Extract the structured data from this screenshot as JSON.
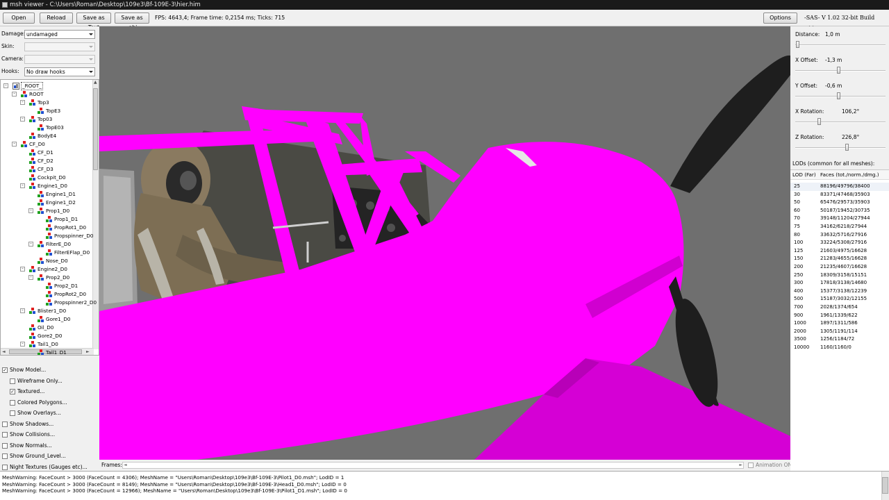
{
  "window": {
    "title": "msh viewer - C:\\Users\\Roman\\Desktop\\109e3\\Bf-109E-3\\hier.him"
  },
  "toolbar": {
    "open_label": "Open",
    "reload_label": "Reload",
    "save_text_label": "Save as Text",
    "save_obj_label": "Save as .obj",
    "stats": "FPS: 4643,4; Frame time: 0,2154 ms; Ticks: 715",
    "options_label": "Options",
    "build": "-SAS- V 1.02  32-bit  Build 311e"
  },
  "left": {
    "damage_label": "Damage:",
    "damage_value": "undamaged",
    "skin_label": "Skin:",
    "skin_value": "",
    "camera_label": "Camera:",
    "camera_value": "",
    "hooks_label": "Hooks:",
    "hooks_value": "No draw hooks"
  },
  "tree": [
    {
      "label": "_ROOT_",
      "depth": 0,
      "exp": "-",
      "icon": "root"
    },
    {
      "label": "ROOT",
      "depth": 1,
      "exp": "-",
      "icon": "node"
    },
    {
      "label": "Top3",
      "depth": 2,
      "exp": "-",
      "icon": "node"
    },
    {
      "label": "TopE3",
      "depth": 3,
      "exp": "",
      "icon": "mesh"
    },
    {
      "label": "Top03",
      "depth": 2,
      "exp": "-",
      "icon": "node"
    },
    {
      "label": "TopE03",
      "depth": 3,
      "exp": "",
      "icon": "mesh"
    },
    {
      "label": "BodyE4",
      "depth": 2,
      "exp": "",
      "icon": "mesh"
    },
    {
      "label": "CF_D0",
      "depth": 1,
      "exp": "-",
      "icon": "node"
    },
    {
      "label": "CF_D1",
      "depth": 2,
      "exp": "",
      "icon": "mesh"
    },
    {
      "label": "CF_D2",
      "depth": 2,
      "exp": "",
      "icon": "mesh"
    },
    {
      "label": "CF_D3",
      "depth": 2,
      "exp": "",
      "icon": "mesh"
    },
    {
      "label": "Cockpit_D0",
      "depth": 2,
      "exp": "",
      "icon": "mesh"
    },
    {
      "label": "Engine1_D0",
      "depth": 2,
      "exp": "-",
      "icon": "node"
    },
    {
      "label": "Engine1_D1",
      "depth": 3,
      "exp": "",
      "icon": "mesh"
    },
    {
      "label": "Engine1_D2",
      "depth": 3,
      "exp": "",
      "icon": "mesh"
    },
    {
      "label": "Prop1_D0",
      "depth": 3,
      "exp": "-",
      "icon": "node"
    },
    {
      "label": "Prop1_D1",
      "depth": 4,
      "exp": "",
      "icon": "mesh"
    },
    {
      "label": "PropRot1_D0",
      "depth": 4,
      "exp": "",
      "icon": "mesh"
    },
    {
      "label": "Propspinner_D0",
      "depth": 4,
      "exp": "",
      "icon": "mesh"
    },
    {
      "label": "FilterE_D0",
      "depth": 3,
      "exp": "-",
      "icon": "node"
    },
    {
      "label": "FilterEFlap_D0",
      "depth": 4,
      "exp": "",
      "icon": "mesh"
    },
    {
      "label": "Nose_D0",
      "depth": 3,
      "exp": "",
      "icon": "mesh"
    },
    {
      "label": "Engine2_D0",
      "depth": 2,
      "exp": "-",
      "icon": "node"
    },
    {
      "label": "Prop2_D0",
      "depth": 3,
      "exp": "-",
      "icon": "node"
    },
    {
      "label": "Prop2_D1",
      "depth": 4,
      "exp": "",
      "icon": "mesh"
    },
    {
      "label": "PropRot2_D0",
      "depth": 4,
      "exp": "",
      "icon": "mesh"
    },
    {
      "label": "Propspinner2_D0",
      "depth": 4,
      "exp": "",
      "icon": "mesh"
    },
    {
      "label": "Blister1_D0",
      "depth": 2,
      "exp": "-",
      "icon": "node"
    },
    {
      "label": "Gore1_D0",
      "depth": 3,
      "exp": "",
      "icon": "mesh"
    },
    {
      "label": "Oil_D0",
      "depth": 2,
      "exp": "",
      "icon": "mesh"
    },
    {
      "label": "Gore2_D0",
      "depth": 2,
      "exp": "",
      "icon": "mesh"
    },
    {
      "label": "Tail1_D0",
      "depth": 2,
      "exp": "-",
      "icon": "node"
    },
    {
      "label": "Tail1_D1",
      "depth": 3,
      "exp": "",
      "icon": "mesh"
    }
  ],
  "checks": [
    {
      "label": "Show Model...",
      "checked": true,
      "indent": 0
    },
    {
      "label": "Wireframe Only...",
      "checked": false,
      "indent": 1
    },
    {
      "label": "Textured...",
      "checked": true,
      "indent": 1
    },
    {
      "label": "Colored Polygons...",
      "checked": false,
      "indent": 1
    },
    {
      "label": "Show Overlays...",
      "checked": false,
      "indent": 1
    },
    {
      "label": "Show Shadows...",
      "checked": false,
      "indent": 0
    },
    {
      "label": "Show Collisions...",
      "checked": false,
      "indent": 0
    },
    {
      "label": "Show Normals...",
      "checked": false,
      "indent": 0
    },
    {
      "label": "Show Ground_Level...",
      "checked": false,
      "indent": 0
    },
    {
      "label": "Night Textures (Gauges etc)...",
      "checked": false,
      "indent": 0
    }
  ],
  "frames": {
    "label": "Frames:",
    "animation_label": "Animation ON"
  },
  "right": {
    "sliders": [
      {
        "label": "Distance:",
        "value": "1,0 m",
        "pos": 0.02
      },
      {
        "label": "X Offset:",
        "value": "-1,3 m",
        "pos": 0.49
      },
      {
        "label": "Y Offset:",
        "value": "-0,6 m",
        "pos": 0.49
      },
      {
        "label": "X Rotation:",
        "value": "106,2°",
        "pos": 0.27
      },
      {
        "label": "Z Rotation:",
        "value": "226,8°",
        "pos": 0.59
      }
    ],
    "lod_title": "LODs (common for all meshes):",
    "lod_headers": [
      "LOD (Far)",
      "Faces (tot./norm./dmg.)"
    ],
    "lods": [
      [
        "25",
        "88196/49796/38400"
      ],
      [
        "30",
        "83371/47468/35903"
      ],
      [
        "50",
        "65476/29573/35903"
      ],
      [
        "60",
        "50187/19452/30735"
      ],
      [
        "70",
        "39148/11204/27944"
      ],
      [
        "75",
        "34162/6218/27944"
      ],
      [
        "80",
        "33632/5716/27916"
      ],
      [
        "100",
        "33224/5308/27916"
      ],
      [
        "125",
        "21603/4975/16628"
      ],
      [
        "150",
        "21283/4655/16628"
      ],
      [
        "200",
        "21235/4607/16628"
      ],
      [
        "250",
        "18309/3158/15151"
      ],
      [
        "300",
        "17818/3138/14680"
      ],
      [
        "400",
        "15377/3138/12239"
      ],
      [
        "500",
        "15187/3032/12155"
      ],
      [
        "700",
        "2028/1374/654"
      ],
      [
        "900",
        "1961/1339/622"
      ],
      [
        "1000",
        "1897/1311/586"
      ],
      [
        "2000",
        "1305/1191/114"
      ],
      [
        "3500",
        "1256/1184/72"
      ],
      [
        "10000",
        "1160/1160/0"
      ]
    ]
  },
  "log": [
    "MeshWarning: FaceCount > 3000 (FaceCount = 4306); MeshName = \"Users\\Roman\\Desktop\\109e3\\Bf-109E-3\\Pilot1_D0.msh\"; LodID = 1",
    "MeshWarning: FaceCount > 3000 (FaceCount = 8149); MeshName = \"Users\\Roman\\Desktop\\109e3\\Bf-109E-3\\Head1_D0.msh\"; LodID = 0",
    "MeshWarning: FaceCount > 3000 (FaceCount = 12966); MeshName = \"Users\\Roman\\Desktop\\109e3\\Bf-109E-3\\Pilot1_D1.msh\"; LodID = 0"
  ],
  "colors": {
    "model": "#ff00ff",
    "viewport_bg": "#6f6f6f",
    "propeller": "#1e1e1e"
  }
}
